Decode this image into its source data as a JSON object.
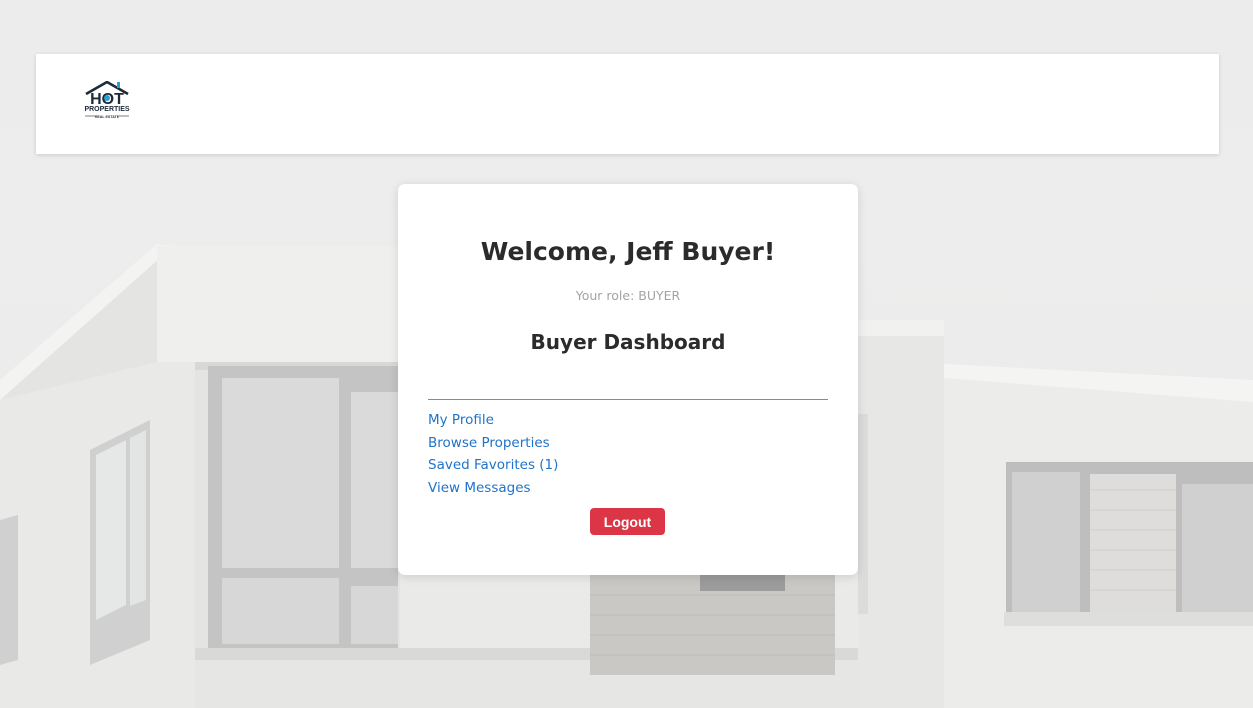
{
  "header": {
    "logo": {
      "line1": "HOT",
      "line2": "PROPERTIES",
      "line3": "REAL ESTATE"
    }
  },
  "card": {
    "welcome": "Welcome, Jeff Buyer!",
    "role_text": "Your role: BUYER",
    "dashboard_title": "Buyer Dashboard",
    "links": [
      {
        "label": "My Profile"
      },
      {
        "label": "Browse Properties"
      },
      {
        "label": "Saved Favorites (1)"
      },
      {
        "label": "View Messages"
      }
    ],
    "logout_label": "Logout"
  },
  "colors": {
    "link": "#1f73c9",
    "logout": "#dc3545",
    "heading": "#2b2b2b",
    "muted": "#a3a3a3",
    "logo_dark": "#1e2a3a",
    "logo_accent": "#2a9fd6"
  },
  "icons": {
    "logo": "house-logo-icon"
  }
}
